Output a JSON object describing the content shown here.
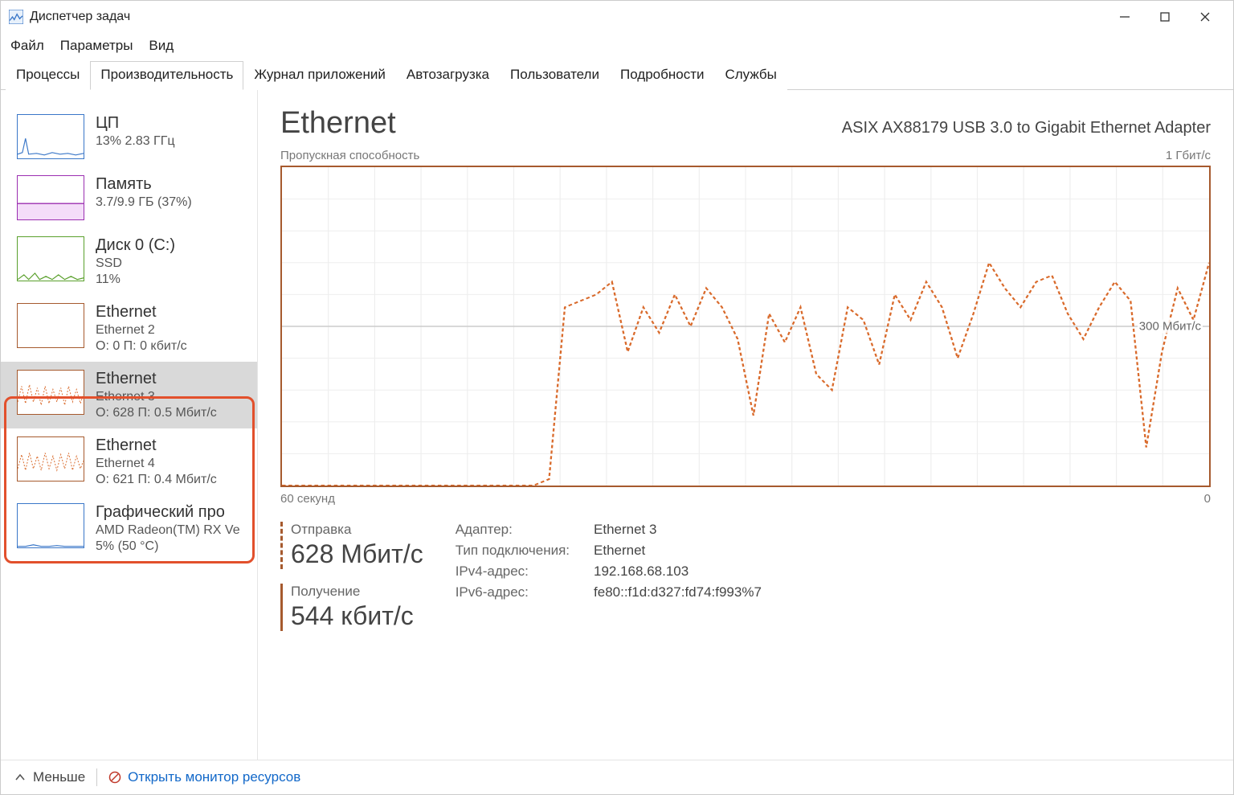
{
  "app": {
    "title": "Диспетчер задач"
  },
  "menu": {
    "file": "Файл",
    "options": "Параметры",
    "view": "Вид"
  },
  "tabs": {
    "processes": "Процессы",
    "performance": "Производительность",
    "app_history": "Журнал приложений",
    "startup": "Автозагрузка",
    "users": "Пользователи",
    "details": "Подробности",
    "services": "Службы",
    "active": "performance"
  },
  "sidebar": {
    "items": [
      {
        "id": "cpu",
        "title": "ЦП",
        "line2": "13%  2.83 ГГц",
        "line3": "",
        "color": "#3a77c8"
      },
      {
        "id": "memory",
        "title": "Память",
        "line2": "3.7/9.9 ГБ (37%)",
        "line3": "",
        "color": "#9b2fb1"
      },
      {
        "id": "disk0",
        "title": "Диск 0 (C:)",
        "line2": "SSD",
        "line3": "11%",
        "color": "#5aa02c"
      },
      {
        "id": "eth2",
        "title": "Ethernet",
        "line2": "Ethernet 2",
        "line3": "О: 0  П: 0 кбит/с",
        "color": "#a65a2e"
      },
      {
        "id": "eth3",
        "title": "Ethernet",
        "line2": "Ethernet 3",
        "line3": "О: 628  П: 0.5 Мбит/с",
        "color": "#a65a2e",
        "selected": true
      },
      {
        "id": "eth4",
        "title": "Ethernet",
        "line2": "Ethernet 4",
        "line3": "О: 621  П: 0.4 Мбит/с",
        "color": "#a65a2e"
      },
      {
        "id": "gpu",
        "title": "Графический про",
        "line2": "AMD Radeon(TM) RX Ve",
        "line3": "5% (50 °C)",
        "color": "#3a77c8"
      }
    ]
  },
  "main": {
    "title": "Ethernet",
    "subtitle": "ASIX AX88179 USB 3.0 to Gigabit Ethernet Adapter",
    "chart_top_left": "Пропускная способность",
    "chart_top_right": "1 Гбит/с",
    "chart_mid_right": "300 Мбит/с",
    "axis_left": "60 секунд",
    "axis_right": "0",
    "send_label": "Отправка",
    "send_value": "628 Мбит/с",
    "recv_label": "Получение",
    "recv_value": "544 кбит/с",
    "info": {
      "adapter_k": "Адаптер:",
      "adapter_v": "Ethernet 3",
      "conn_k": "Тип подключения:",
      "conn_v": "Ethernet",
      "ipv4_k": "IPv4-адрес:",
      "ipv4_v": "192.168.68.103",
      "ipv6_k": "IPv6-адрес:",
      "ipv6_v": "fe80::f1d:d327:fd74:f993%7"
    }
  },
  "footer": {
    "less": "Меньше",
    "resmon": "Открыть монитор ресурсов"
  },
  "chart_data": {
    "type": "line",
    "title": "Пропускная способность",
    "xlabel": "60 секунд → 0",
    "ylabel": "",
    "ylim": [
      0,
      1000
    ],
    "unit": "Мбит/с",
    "annotations": [
      "300 Мбит/с"
    ],
    "x": [
      0,
      1,
      2,
      3,
      4,
      5,
      6,
      7,
      8,
      9,
      10,
      11,
      12,
      13,
      14,
      15,
      16,
      17,
      18,
      19,
      20,
      21,
      22,
      23,
      24,
      25,
      26,
      27,
      28,
      29,
      30,
      31,
      32,
      33,
      34,
      35,
      36,
      37,
      38,
      39,
      40,
      41,
      42,
      43,
      44,
      45,
      46,
      47,
      48,
      49,
      50,
      51,
      52,
      53,
      54,
      55,
      56,
      57,
      58,
      59
    ],
    "series": [
      {
        "name": "Отправка",
        "values": [
          0,
          0,
          0,
          0,
          0,
          0,
          0,
          0,
          0,
          0,
          0,
          0,
          0,
          0,
          0,
          0,
          0,
          20,
          560,
          580,
          600,
          640,
          420,
          560,
          480,
          600,
          500,
          620,
          560,
          460,
          220,
          540,
          450,
          560,
          350,
          300,
          560,
          520,
          380,
          600,
          520,
          640,
          560,
          400,
          540,
          700,
          620,
          560,
          640,
          660,
          540,
          460,
          560,
          640,
          580,
          120,
          420,
          620,
          520,
          700
        ]
      },
      {
        "name": "Получение",
        "values": [
          0,
          0,
          0,
          0,
          0,
          0,
          0,
          0,
          0,
          0,
          0,
          0,
          0,
          0,
          0,
          0,
          0,
          1,
          1,
          1,
          1,
          1,
          1,
          1,
          1,
          1,
          1,
          1,
          1,
          1,
          1,
          1,
          1,
          1,
          1,
          1,
          1,
          1,
          1,
          1,
          1,
          1,
          1,
          1,
          1,
          1,
          1,
          1,
          1,
          1,
          1,
          1,
          1,
          1,
          1,
          1,
          1,
          1,
          1,
          1
        ]
      }
    ]
  }
}
